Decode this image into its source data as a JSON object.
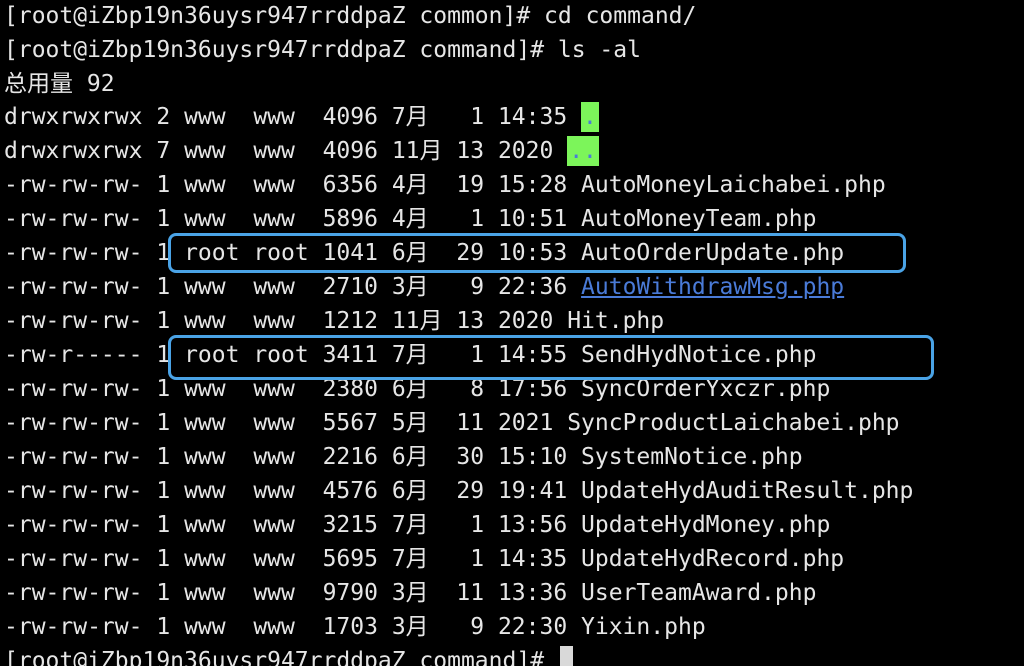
{
  "terminal": {
    "prompt1": "[root@iZbp19n36uysr947rrddpaZ common]# cd command/",
    "prompt2": "[root@iZbp19n36uysr947rrddpaZ command]# ls -al",
    "total": "总用量 92",
    "rows": [
      {
        "perm": "drwxrwxrwx",
        "links": "2",
        "owner": "www ",
        "group": "www ",
        "size": "4096",
        "month": "7月 ",
        "day": " 1",
        "time": "14:35",
        "name": "."
      },
      {
        "perm": "drwxrwxrwx",
        "links": "7",
        "owner": "www ",
        "group": "www ",
        "size": "4096",
        "month": "11月",
        "day": "13",
        "time": "2020",
        "name": ".."
      },
      {
        "perm": "-rw-rw-rw-",
        "links": "1",
        "owner": "www ",
        "group": "www ",
        "size": "6356",
        "month": "4月 ",
        "day": "19",
        "time": "15:28",
        "name": "AutoMoneyLaichabei.php"
      },
      {
        "perm": "-rw-rw-rw-",
        "links": "1",
        "owner": "www ",
        "group": "www ",
        "size": "5896",
        "month": "4月 ",
        "day": " 1",
        "time": "10:51",
        "name": "AutoMoneyTeam.php"
      },
      {
        "perm": "-rw-rw-rw-",
        "links": "1",
        "owner": "root",
        "group": "root",
        "size": "1041",
        "month": "6月 ",
        "day": "29",
        "time": "10:53",
        "name": "AutoOrderUpdate.php"
      },
      {
        "perm": "-rw-rw-rw-",
        "links": "1",
        "owner": "www ",
        "group": "www ",
        "size": "2710",
        "month": "3月 ",
        "day": " 9",
        "time": "22:36",
        "name": "AutoWithdrawMsg.php"
      },
      {
        "perm": "-rw-rw-rw-",
        "links": "1",
        "owner": "www ",
        "group": "www ",
        "size": "1212",
        "month": "11月",
        "day": "13",
        "time": "2020",
        "name": "Hit.php"
      },
      {
        "perm": "-rw-r-----",
        "links": "1",
        "owner": "root",
        "group": "root",
        "size": "3411",
        "month": "7月 ",
        "day": " 1",
        "time": "14:55",
        "name": "SendHydNotice.php"
      },
      {
        "perm": "-rw-rw-rw-",
        "links": "1",
        "owner": "www ",
        "group": "www ",
        "size": "2380",
        "month": "6月 ",
        "day": " 8",
        "time": "17:56",
        "name": "SyncOrderYxczr.php"
      },
      {
        "perm": "-rw-rw-rw-",
        "links": "1",
        "owner": "www ",
        "group": "www ",
        "size": "5567",
        "month": "5月 ",
        "day": "11",
        "time": "2021",
        "name": "SyncProductLaichabei.php"
      },
      {
        "perm": "-rw-rw-rw-",
        "links": "1",
        "owner": "www ",
        "group": "www ",
        "size": "2216",
        "month": "6月 ",
        "day": "30",
        "time": "15:10",
        "name": "SystemNotice.php"
      },
      {
        "perm": "-rw-rw-rw-",
        "links": "1",
        "owner": "www ",
        "group": "www ",
        "size": "4576",
        "month": "6月 ",
        "day": "29",
        "time": "19:41",
        "name": "UpdateHydAuditResult.php"
      },
      {
        "perm": "-rw-rw-rw-",
        "links": "1",
        "owner": "www ",
        "group": "www ",
        "size": "3215",
        "month": "7月 ",
        "day": " 1",
        "time": "13:56",
        "name": "UpdateHydMoney.php"
      },
      {
        "perm": "-rw-rw-rw-",
        "links": "1",
        "owner": "www ",
        "group": "www ",
        "size": "5695",
        "month": "7月 ",
        "day": " 1",
        "time": "14:35",
        "name": "UpdateHydRecord.php"
      },
      {
        "perm": "-rw-rw-rw-",
        "links": "1",
        "owner": "www ",
        "group": "www ",
        "size": "9790",
        "month": "3月 ",
        "day": "11",
        "time": "13:36",
        "name": "UserTeamAward.php"
      },
      {
        "perm": "-rw-rw-rw-",
        "links": "1",
        "owner": "www ",
        "group": "www ",
        "size": "1703",
        "month": "3月 ",
        "day": " 9",
        "time": "22:30",
        "name": "Yixin.php"
      }
    ],
    "prompt3": "[root@iZbp19n36uysr947rrddpaZ command]# "
  },
  "colors": {
    "background": "#000000",
    "text": "#e6e6e6",
    "dir_fg": "#4a7bd8",
    "dir_bg": "#7cf55a",
    "highlight_box": "#4aa3e6"
  }
}
